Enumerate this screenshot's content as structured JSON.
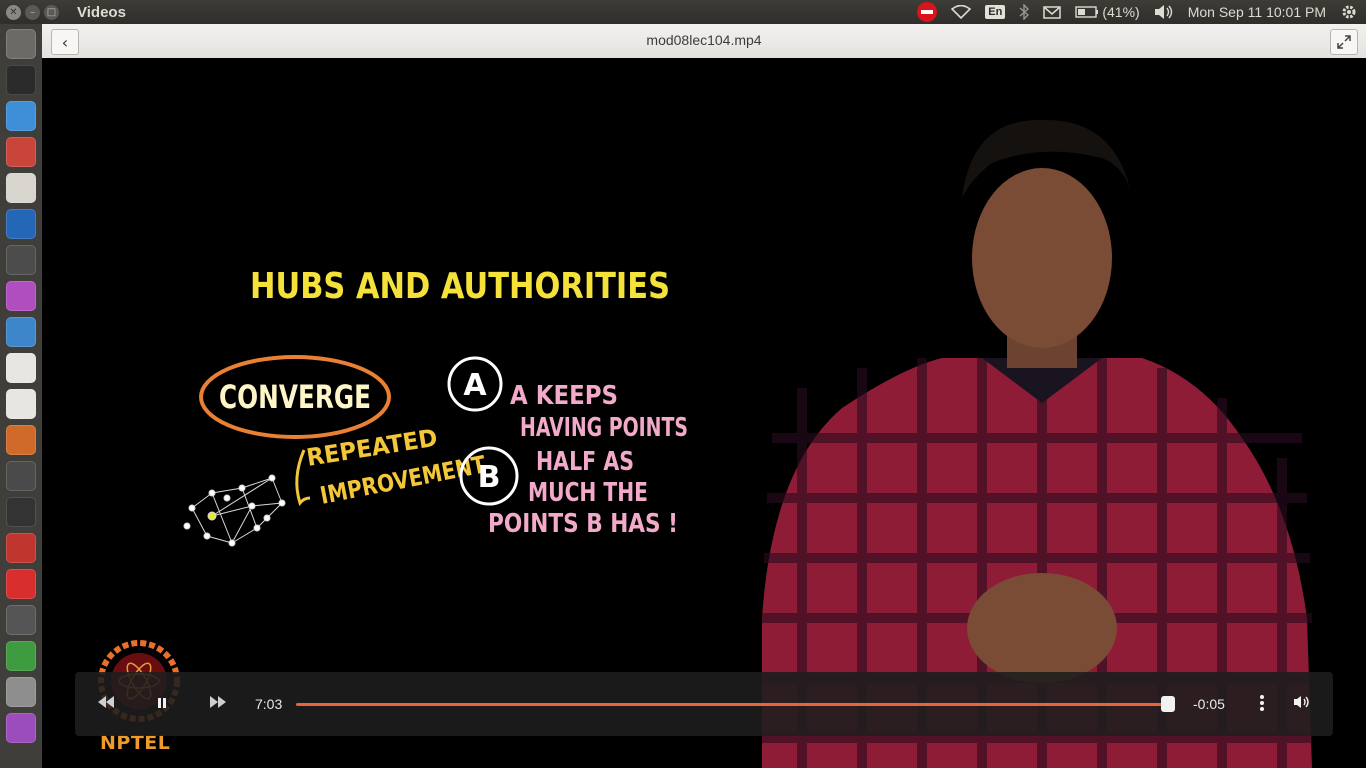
{
  "panel": {
    "app_title": "Videos",
    "keyboard_layout": "En",
    "battery": "(41%)",
    "datetime": "Mon Sep 11 10:01 PM"
  },
  "window": {
    "title": "mod08lec104.mp4"
  },
  "launcher": {
    "items": [
      {
        "name": "dash-icon",
        "color": "#6c6a66"
      },
      {
        "name": "terminal-icon",
        "color": "#2b2b2b"
      },
      {
        "name": "chrome-icon",
        "color": "#3e8ed8"
      },
      {
        "name": "files-icon",
        "color": "#c9453a"
      },
      {
        "name": "document-viewer-icon",
        "color": "#d8d4ce"
      },
      {
        "name": "r-icon",
        "color": "#2467b6"
      },
      {
        "name": "video-editor-icon",
        "color": "#4c4c4c"
      },
      {
        "name": "presentation-icon",
        "color": "#b04ec0"
      },
      {
        "name": "writer-icon",
        "color": "#3d86c9"
      },
      {
        "name": "text-editor-icon",
        "color": "#e8e6e0"
      },
      {
        "name": "gmail-icon",
        "color": "#e8e6e0"
      },
      {
        "name": "impress-icon",
        "color": "#d06a2a"
      },
      {
        "name": "sublime-icon",
        "color": "#4a4a4a"
      },
      {
        "name": "ipython-icon",
        "color": "#333333"
      },
      {
        "name": "settings-app-icon",
        "color": "#c0352e"
      },
      {
        "name": "opera-icon",
        "color": "#d82e2e"
      },
      {
        "name": "geogebra-icon",
        "color": "#555555"
      },
      {
        "name": "calc-icon",
        "color": "#3f9b3f"
      },
      {
        "name": "drive-icon",
        "color": "#8e8e8e"
      },
      {
        "name": "installer-icon",
        "color": "#9c4dbc"
      }
    ]
  },
  "player": {
    "elapsed": "7:03",
    "remaining": "-0:05",
    "progress_fraction": 0.993
  },
  "video_frame": {
    "brand": "NPTEL",
    "title": "HUBS AND AUTHORITIES",
    "converge": "CONVERGE",
    "repeated": "REPEATED",
    "improvement": "IMPROVEMENT",
    "node_a": "A",
    "node_b": "B",
    "note_lines": [
      "A KEEPS",
      "HAVING POINTS",
      "HALF AS",
      "MUCH THE",
      "POINTS  B  HAS !"
    ]
  }
}
